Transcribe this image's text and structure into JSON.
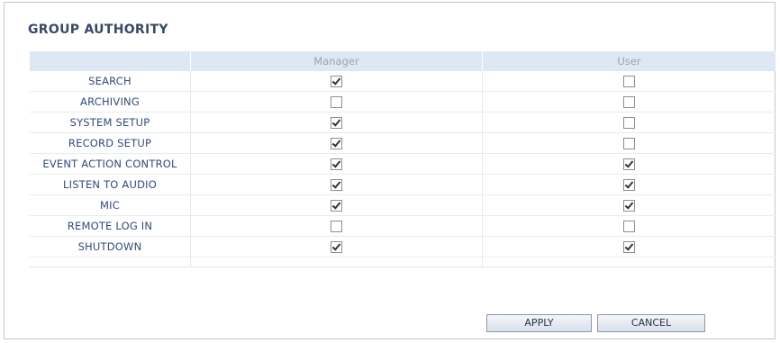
{
  "panel": {
    "title": "GROUP AUTHORITY"
  },
  "table": {
    "columns": [
      "",
      "Manager",
      "User"
    ],
    "rows": [
      {
        "label": "SEARCH",
        "manager": true,
        "user": false
      },
      {
        "label": "ARCHIVING",
        "manager": false,
        "user": false
      },
      {
        "label": "SYSTEM SETUP",
        "manager": true,
        "user": false
      },
      {
        "label": "RECORD SETUP",
        "manager": true,
        "user": false
      },
      {
        "label": "EVENT ACTION CONTROL",
        "manager": true,
        "user": true
      },
      {
        "label": "LISTEN TO AUDIO",
        "manager": true,
        "user": true
      },
      {
        "label": "MIC",
        "manager": true,
        "user": true
      },
      {
        "label": "REMOTE LOG IN",
        "manager": false,
        "user": false
      },
      {
        "label": "SHUTDOWN",
        "manager": true,
        "user": true
      }
    ]
  },
  "buttons": {
    "apply": "APPLY",
    "cancel": "CANCEL"
  },
  "colors": {
    "title": "#3a4a66",
    "header_bg": "#dde8f4",
    "row_label": "#334b7a"
  }
}
